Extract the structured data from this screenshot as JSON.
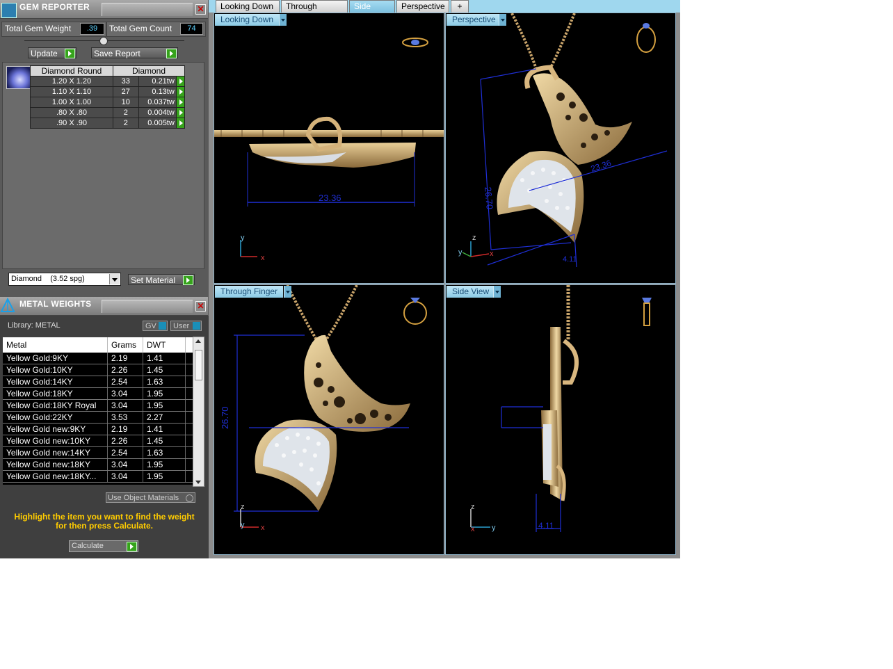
{
  "gem_reporter": {
    "title": "GEM REPORTER",
    "total_weight_label": "Total Gem Weight",
    "total_weight_value": ".39",
    "total_count_label": "Total Gem Count",
    "total_count_value": "74",
    "update_label": "Update",
    "save_report_label": "Save Report",
    "table_headers": [
      "Diamond Round",
      "Diamond"
    ],
    "rows": [
      {
        "size": "1.20 X 1.20",
        "count": "33",
        "weight": "0.21tw"
      },
      {
        "size": "1.10 X 1.10",
        "count": "27",
        "weight": "0.13tw"
      },
      {
        "size": "1.00 X 1.00",
        "count": "10",
        "weight": "0.037tw"
      },
      {
        "size": ".80 X .80",
        "count": "2",
        "weight": "0.004tw"
      },
      {
        "size": ".90 X .90",
        "count": "2",
        "weight": "0.005tw"
      }
    ],
    "material_select": "Diamond    (3.52 spg)",
    "set_material_label": "Set Material"
  },
  "metal_weights": {
    "title": "METAL WEIGHTS",
    "library_label": "Library: METAL",
    "gv_label": "GV",
    "user_label": "User",
    "headers": [
      "Metal",
      "Grams",
      "DWT"
    ],
    "rows": [
      {
        "metal": "Yellow Gold:9KY",
        "grams": "2.19",
        "dwt": "1.41"
      },
      {
        "metal": "Yellow Gold:10KY",
        "grams": "2.26",
        "dwt": "1.45"
      },
      {
        "metal": "Yellow Gold:14KY",
        "grams": "2.54",
        "dwt": "1.63"
      },
      {
        "metal": "Yellow Gold:18KY",
        "grams": "3.04",
        "dwt": "1.95"
      },
      {
        "metal": "Yellow Gold:18KY Royal",
        "grams": "3.04",
        "dwt": "1.95"
      },
      {
        "metal": "Yellow Gold:22KY",
        "grams": "3.53",
        "dwt": "2.27"
      },
      {
        "metal": "Yellow Gold new:9KY",
        "grams": "2.19",
        "dwt": "1.41"
      },
      {
        "metal": "Yellow Gold new:10KY",
        "grams": "2.26",
        "dwt": "1.45"
      },
      {
        "metal": "Yellow Gold new:14KY",
        "grams": "2.54",
        "dwt": "1.63"
      },
      {
        "metal": "Yellow Gold new:18KY",
        "grams": "3.04",
        "dwt": "1.95"
      },
      {
        "metal": "Yellow Gold new:18KY...",
        "grams": "3.04",
        "dwt": "1.95"
      }
    ],
    "use_object_materials_label": "Use Object Materials",
    "hint_line1": "Highlight the item you want to find the weight",
    "hint_line2": "for then press Calculate.",
    "calculate_label": "Calculate"
  },
  "tabs": [
    {
      "label": "Looking Down"
    },
    {
      "label": "Through Finger"
    },
    {
      "label": "Side View"
    },
    {
      "label": "Perspective"
    },
    {
      "label": "+"
    }
  ],
  "viewports": {
    "top_left": {
      "label": "Looking Down",
      "dimension": "23.36",
      "axis1": "y",
      "axis2": "x"
    },
    "top_right": {
      "label": "Perspective",
      "dim_height": "26.70",
      "dim_width": "23.36",
      "dim_depth": "4.11",
      "axis1": "z",
      "axis2": "y",
      "axis3": "x"
    },
    "bottom_left": {
      "label": "Through Finger",
      "dimension": "26.70",
      "axis1": "z",
      "axis2": "y",
      "axis3": "x"
    },
    "bottom_right": {
      "label": "Side View",
      "dimension": "4.11",
      "axis1": "z",
      "axis2": "x",
      "axis3": "y"
    }
  },
  "colors": {
    "gold": "#c9a46a",
    "dimension_blue": "#1f2fd6",
    "active_tab": "#7cc0df",
    "hint_yellow": "#ffcc00"
  }
}
